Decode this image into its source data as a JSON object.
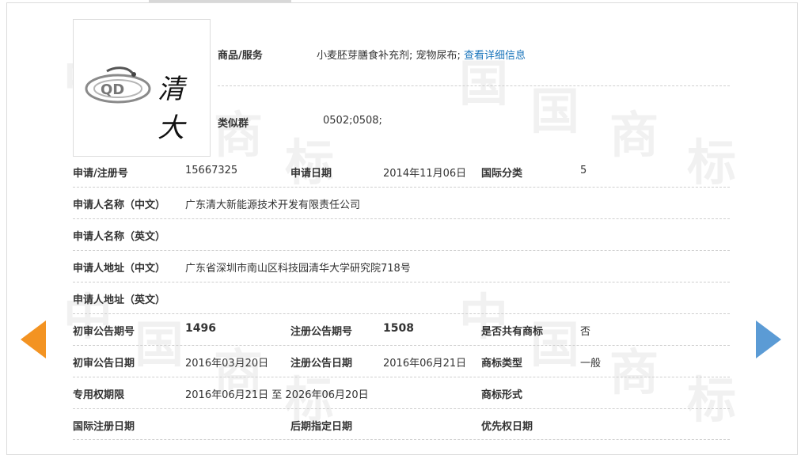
{
  "watermark": [
    "中",
    "国",
    "商",
    "标",
    "中",
    "国",
    "商",
    "标",
    "中",
    "国",
    "商",
    "标"
  ],
  "logo": {
    "latin": "QD",
    "chinese": "清大"
  },
  "goods": {
    "label": "商品/服务",
    "value": "小麦胚芽膳食补充剂; 宠物尿布; ",
    "link": "查看详细信息"
  },
  "similar_group": {
    "label": "类似群",
    "value": "0502;0508;"
  },
  "rows": {
    "reg_no": {
      "label": "申请/注册号",
      "value": "15667325"
    },
    "app_date": {
      "label": "申请日期",
      "value": "2014年11月06日"
    },
    "intl_class": {
      "label": "国际分类",
      "value": "5"
    },
    "applicant_cn": {
      "label": "申请人名称（中文）",
      "value": "广东清大新能源技术开发有限责任公司"
    },
    "applicant_en": {
      "label": "申请人名称（英文）",
      "value": ""
    },
    "address_cn": {
      "label": "申请人地址（中文）",
      "value": "广东省深圳市南山区科技园清华大学研究院718号"
    },
    "address_en": {
      "label": "申请人地址（英文）",
      "value": ""
    },
    "prelim_no": {
      "label": "初审公告期号",
      "value": "1496"
    },
    "reg_pub_no": {
      "label": "注册公告期号",
      "value": "1508"
    },
    "shared": {
      "label": "是否共有商标",
      "value": "否"
    },
    "prelim_date": {
      "label": "初审公告日期",
      "value": "2016年03月20日"
    },
    "reg_pub_date": {
      "label": "注册公告日期",
      "value": "2016年06月21日"
    },
    "mark_type": {
      "label": "商标类型",
      "value": "一般"
    },
    "exclusive_period": {
      "label": "专用权期限",
      "value": "2016年06月21日 至 2026年06月20日"
    },
    "mark_form": {
      "label": "商标形式",
      "value": ""
    },
    "intl_reg_date": {
      "label": "国际注册日期",
      "value": ""
    },
    "later_designation_date": {
      "label": "后期指定日期",
      "value": ""
    },
    "priority_date": {
      "label": "优先权日期",
      "value": ""
    }
  },
  "colors": {
    "prev_arrow": "#f39322",
    "next_arrow": "#5b9bd5",
    "link": "#1a75bb"
  },
  "icons": {
    "prev": "arrow-left-icon",
    "next": "arrow-right-icon"
  }
}
